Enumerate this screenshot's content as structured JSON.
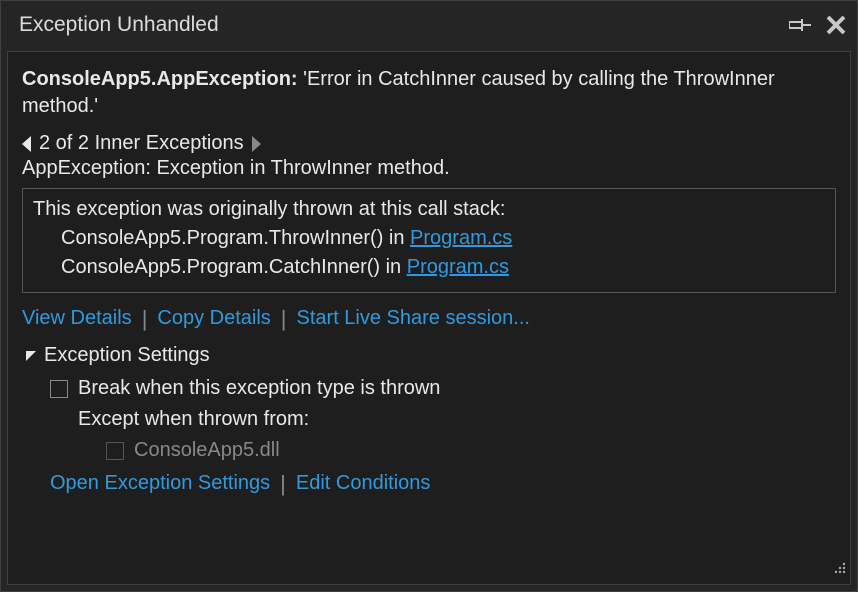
{
  "titlebar": {
    "title": "Exception Unhandled"
  },
  "exception": {
    "type": "ConsoleApp5.AppException:",
    "message": "'Error in CatchInner caused by calling the ThrowInner method.'"
  },
  "inner": {
    "nav_text": "2 of 2 Inner Exceptions",
    "detail": "AppException: Exception in ThrowInner method."
  },
  "callstack": {
    "intro": "This exception was originally thrown at this call stack:",
    "frames": [
      {
        "text": "ConsoleApp5.Program.ThrowInner() in ",
        "file": "Program.cs"
      },
      {
        "text": "ConsoleApp5.Program.CatchInner() in ",
        "file": "Program.cs"
      }
    ]
  },
  "actions": {
    "view_details": "View Details",
    "copy_details": "Copy Details",
    "live_share": "Start Live Share session..."
  },
  "settings": {
    "header": "Exception Settings",
    "break_label": "Break when this exception type is thrown",
    "except_label": "Except when thrown from:",
    "dll": "ConsoleApp5.dll",
    "open_settings": "Open Exception Settings",
    "edit_conditions": "Edit Conditions"
  }
}
